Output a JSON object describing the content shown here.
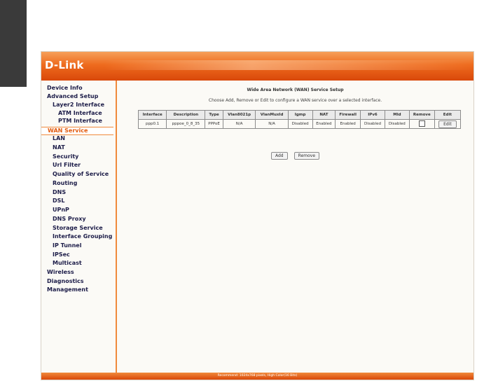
{
  "brand": {
    "logo": "D-Link"
  },
  "sidebar": {
    "items": [
      {
        "label": "Device Info"
      },
      {
        "label": "Advanced Setup"
      },
      {
        "label": "Layer2 Interface"
      },
      {
        "label": "ATM Interface"
      },
      {
        "label": "PTM Interface"
      },
      {
        "label": "WAN Service"
      },
      {
        "label": "LAN"
      },
      {
        "label": "NAT"
      },
      {
        "label": "Security"
      },
      {
        "label": "Url Filter"
      },
      {
        "label": "Quality of Service"
      },
      {
        "label": "Routing"
      },
      {
        "label": "DNS"
      },
      {
        "label": "DSL"
      },
      {
        "label": "UPnP"
      },
      {
        "label": "DNS Proxy"
      },
      {
        "label": "Storage Service"
      },
      {
        "label": "Interface Grouping"
      },
      {
        "label": "IP Tunnel"
      },
      {
        "label": "IPSec"
      },
      {
        "label": "Multicast"
      },
      {
        "label": "Wireless"
      },
      {
        "label": "Diagnostics"
      },
      {
        "label": "Management"
      }
    ],
    "active": "WAN Service"
  },
  "main": {
    "title": "Wide Area Network (WAN) Service Setup",
    "instructions": "Choose Add, Remove or Edit to configure a WAN service over a selected interface.",
    "table": {
      "headers": [
        "Interface",
        "Description",
        "Type",
        "Vlan8021p",
        "VlanMuxId",
        "Igmp",
        "NAT",
        "Firewall",
        "IPv6",
        "Mld",
        "Remove",
        "Edit"
      ],
      "rows": [
        [
          "ppp0.1",
          "pppoe_0_8_35",
          "PPPoE",
          "N/A",
          "N/A",
          "Disabled",
          "Enabled",
          "Enabled",
          "Disabled",
          "Disabled",
          "",
          "Edit"
        ]
      ]
    },
    "add_label": "Add",
    "remove_label": "Remove"
  },
  "footer": {
    "text": "Recommend: 1024x768 pixels, High Color(16 Bits)"
  },
  "colors": {
    "accent": "#ee6b1e",
    "active_nav": "#e25a0e",
    "nav_text": "#1c1c48"
  }
}
